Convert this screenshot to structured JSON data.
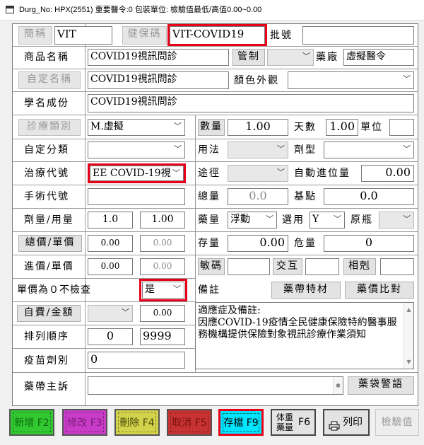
{
  "window": {
    "title": "Durg_No:  HPX(2551) 重要醫令:0 包裝單位:  檢驗值最低/高值0.00~0.00"
  },
  "labels": {
    "abbr_btn": "簡稱",
    "nhi_code_btn": "健保碼",
    "batch_no": "批號",
    "product_name": "商品名稱",
    "control_btn": "管制",
    "manufacturer": "藥廠",
    "custom_name_btn": "自定名稱",
    "color_look": "顏色外觀",
    "generic_name": "學名成份",
    "diagnosis_cat_btn": "診療類別",
    "quantity_btn": "數量",
    "days": "天數",
    "unit": "單位",
    "custom_class": "自定分類",
    "usage": "用法",
    "dosage_form": "劑型",
    "treatment_code": "治療代號",
    "route": "途徑",
    "auto_carry": "自動進位量",
    "surgery_code": "手術代號",
    "total": "總量",
    "base_point": "基點",
    "dose_usage": "劑量/用量",
    "drug_qty": "藥量",
    "select_use": "選用",
    "orig_bottle": "原瓶",
    "total_unit_price_btn": "總價/單價",
    "stock": "存量",
    "danger_qty": "危量",
    "in_price": "進價/單價",
    "sensitive_code_btn": "敏碼",
    "interaction_btn": "交互",
    "incompat_btn": "相剋",
    "zero_price_check": "單價為０不檢查",
    "note": "備註",
    "drug_bag_material_btn": "藥帶特材",
    "price_compare_btn": "藥價比對",
    "self_pay_btn": "自費/金額",
    "sort_order": "排列順序",
    "vaccine_dose": "疫苗劑別",
    "bag_complaint": "藥帶主訴",
    "bag_warning_btn": "藥袋警語"
  },
  "values": {
    "abbr": "VIT",
    "nhi_code": "VIT-COVID19",
    "batch_no": "",
    "product_name": "COVID19視訊問診",
    "control": "",
    "manufacturer": "虛擬醫令",
    "custom_name": "COVID19視訊問診",
    "color_look": "",
    "generic_name": "COVID19視訊問診",
    "diagnosis_cat": "M.虛擬",
    "quantity": "1.00",
    "days": "1.00",
    "unit": "",
    "custom_class": "",
    "usage": "",
    "dosage_form": "",
    "treatment_code": "EE COVID-19視",
    "route": "",
    "auto_carry": "0.00",
    "surgery_code": "",
    "total": "0.0",
    "base_point": "0.0",
    "dose": "1.0",
    "usage_qty": "1.00",
    "drug_qty": "浮動",
    "select_use": "Y",
    "orig_bottle": "",
    "total_price": "0.00",
    "unit_price": "0.00",
    "stock": "0.00",
    "danger_qty": "0",
    "in_price": "0.00",
    "in_unit_price": "0.00",
    "sensitive_code": "",
    "interaction": "",
    "incompat": "",
    "zero_price_check": "是",
    "self_pay": "",
    "self_pay_amount": "0.00",
    "sort_order_a": "0",
    "sort_order_b": "9999",
    "vaccine_dose": "0",
    "indication_note": "適應症及備註:\n因應COVID-19疫情全民健康保險特約醫事服務機構提供保險對象視訊診療作業須知",
    "bag_complaint": ""
  },
  "fkeys": {
    "f2": "新增 F2",
    "f3": "修改 F3",
    "f4": "刪除 F4",
    "f5": "取消 F5",
    "f9": "存檔 F9",
    "f6_top": "体重",
    "f6_bottom": "藥量",
    "f6_key": "F6",
    "print": "列印",
    "lab_value": "檢驗值"
  },
  "colors": {
    "highlight": "#e8001b",
    "save_key": "#00e5ff",
    "add_key": "#32c832",
    "modify_key": "#c83cc8",
    "delete_key": "#d2d24b",
    "cancel_key": "#c83232"
  }
}
